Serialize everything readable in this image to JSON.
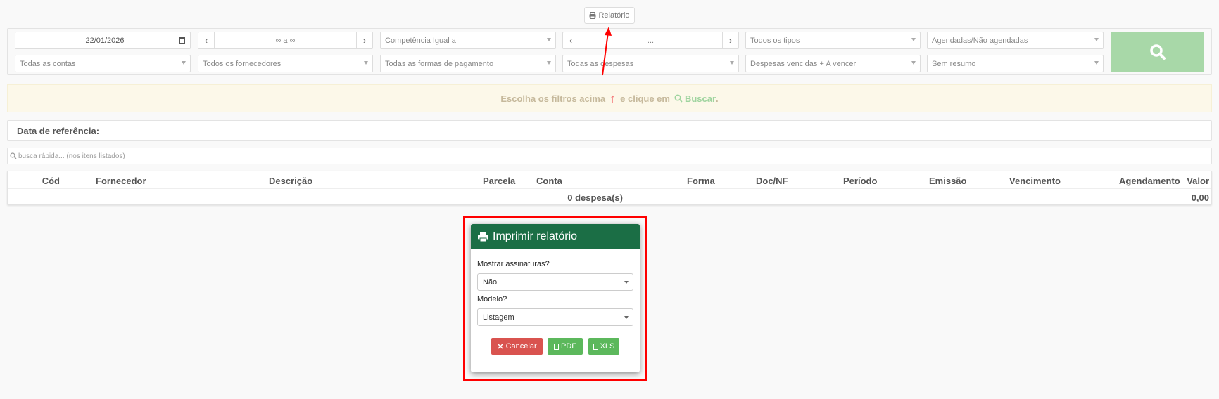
{
  "toolbar": {
    "report_label": "Relatório"
  },
  "filters": {
    "date": "22/01/2026",
    "period_range": "∞ a ∞",
    "competencia": "Competência Igual a",
    "second_range": "...",
    "tipos": "Todos os tipos",
    "agendadas": "Agendadas/Não agendadas",
    "contas": "Todas as contas",
    "fornecedores": "Todos os fornecedores",
    "formas": "Todas as formas de pagamento",
    "despesas": "Todas as despesas",
    "vencimento": "Despesas vencidas + A vencer",
    "resumo": "Sem resumo"
  },
  "banner": {
    "part1": "Escolha os filtros acima",
    "part2": "e clique em",
    "action": "Buscar",
    "end": "."
  },
  "reference": {
    "label": "Data de referência:"
  },
  "quick_search": {
    "placeholder": "busca rápida... (nos itens listados)"
  },
  "table": {
    "headers": [
      "Cód",
      "Fornecedor",
      "Descrição",
      "Parcela",
      "Conta",
      "Forma",
      "Doc/NF",
      "Período",
      "Emissão",
      "Vencimento",
      "Agendamento",
      "Valor"
    ],
    "footer_count": "0 despesa(s)",
    "footer_total": "0,00"
  },
  "modal": {
    "title": "Imprimir relatório",
    "signatures_label": "Mostrar assinaturas?",
    "signatures_value": "Não",
    "model_label": "Modelo?",
    "model_value": "Listagem",
    "cancel": "Cancelar",
    "pdf": "PDF",
    "xls": "XLS"
  },
  "colors": {
    "header_green": "#1b6e45",
    "cancel_red": "#d9534f",
    "ok_green": "#5cb85c",
    "search_green": "#a8d8a8",
    "highlight_red": "#ff0000"
  }
}
